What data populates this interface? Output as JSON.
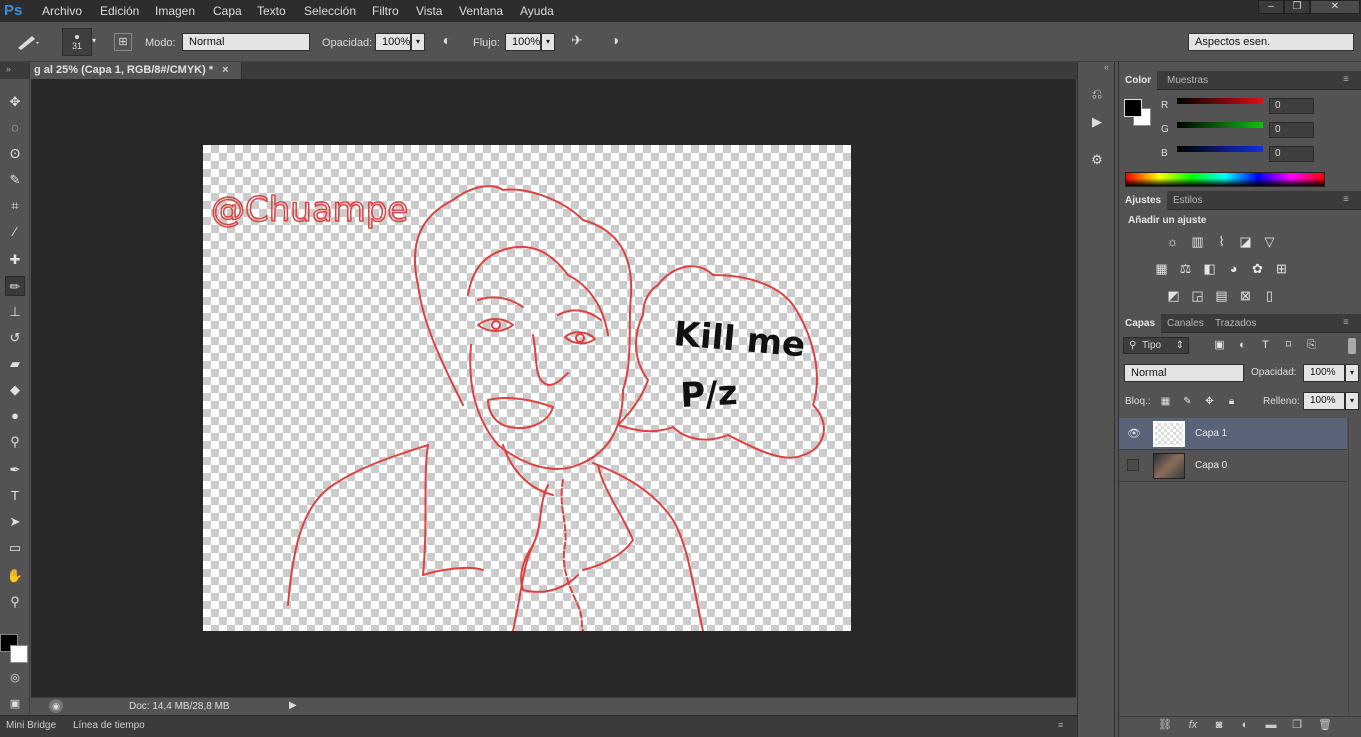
{
  "app": {
    "logo": "Ps",
    "menus": [
      "Archivo",
      "Edición",
      "Imagen",
      "Capa",
      "Texto",
      "Selección",
      "Filtro",
      "Vista",
      "Ventana",
      "Ayuda"
    ],
    "window_controls": [
      "–",
      "❐",
      "✕"
    ]
  },
  "options_bar": {
    "brush_size": "31",
    "mode_label": "Modo:",
    "mode_value": "Normal",
    "opacity_label": "Opacidad:",
    "opacity_value": "100%",
    "flow_label": "Flujo:",
    "flow_value": "100%",
    "workspace_value": "Aspectos esen."
  },
  "document": {
    "tab_title": "g al 25% (Capa 1, RGB/8#/CMYK) *",
    "close": "×",
    "canvas_text": {
      "watermark": "@Chuampe",
      "speech_line1": "Kill me",
      "speech_line2": "P/z"
    },
    "status": "Doc: 14,4 MB/28,8 MB"
  },
  "bottom_tabs": [
    "Mini Bridge",
    "Línea de tiempo"
  ],
  "color_panel": {
    "tabs": [
      "Color",
      "Muestras"
    ],
    "channels": [
      {
        "name": "R",
        "value": "0",
        "color": "#cc2020"
      },
      {
        "name": "G",
        "value": "0",
        "color": "#20b020"
      },
      {
        "name": "B",
        "value": "0",
        "color": "#2040cc"
      }
    ]
  },
  "adjustments_panel": {
    "tabs": [
      "Ajustes",
      "Estilos"
    ],
    "heading": "Añadir un ajuste"
  },
  "layers_panel": {
    "tabs": [
      "Capas",
      "Canales",
      "Trazados"
    ],
    "filter_value": "Tipo",
    "blend_value": "Normal",
    "opacity_label": "Opacidad:",
    "opacity_value": "100%",
    "lock_label": "Bloq.:",
    "fill_label": "Relleno:",
    "fill_value": "100%",
    "layers": [
      {
        "name": "Capa 1",
        "visible": true,
        "selected": true
      },
      {
        "name": "Capa 0",
        "visible": false,
        "selected": false
      }
    ]
  },
  "colors": {
    "accent": "#3d8ed8",
    "drawing_red": "#e04040",
    "selected_layer": "#5a6478"
  }
}
